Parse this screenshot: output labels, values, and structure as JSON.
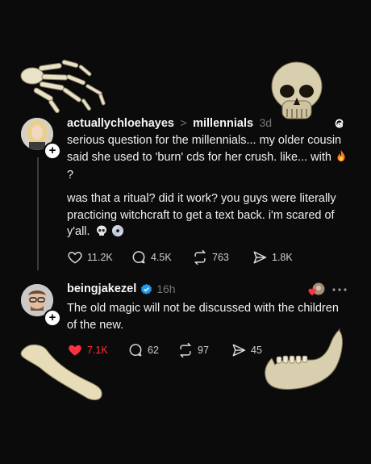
{
  "post": {
    "username": "actuallychloehayes",
    "separator": ">",
    "community": "millennials",
    "time": "3d",
    "paragraph1": "serious question for the millennials... my older cousin said she used to 'burn' cds for her crush. like... with",
    "paragraph1_end": "?",
    "paragraph2": "was that a ritual? did it work? you guys were literally practicing witchcraft to get a text back. i'm scared of y'all.",
    "actions": {
      "likes": "11.2K",
      "replies": "4.5K",
      "reposts": "763",
      "shares": "1.8K"
    }
  },
  "reply": {
    "username": "beingjakezel",
    "time": "16h",
    "text": "The old magic will not be discussed with the children of the new.",
    "actions": {
      "likes": "7.1K",
      "replies": "62",
      "reposts": "97",
      "shares": "45"
    }
  },
  "icons": {
    "threads_logo": "threads-logo-icon",
    "verified": "verified-badge-icon",
    "more": "more-icon",
    "heart": "heart-icon",
    "comment": "comment-icon",
    "repost": "repost-icon",
    "share": "share-icon",
    "fire_emoji": "fire-emoji",
    "skull_emoji": "skull-emoji",
    "cd_emoji": "cd-emoji"
  },
  "colors": {
    "background": "#0b0b0b",
    "liked_red": "#ff3040",
    "verified_blue": "#1d9bf0",
    "muted": "#777777"
  }
}
